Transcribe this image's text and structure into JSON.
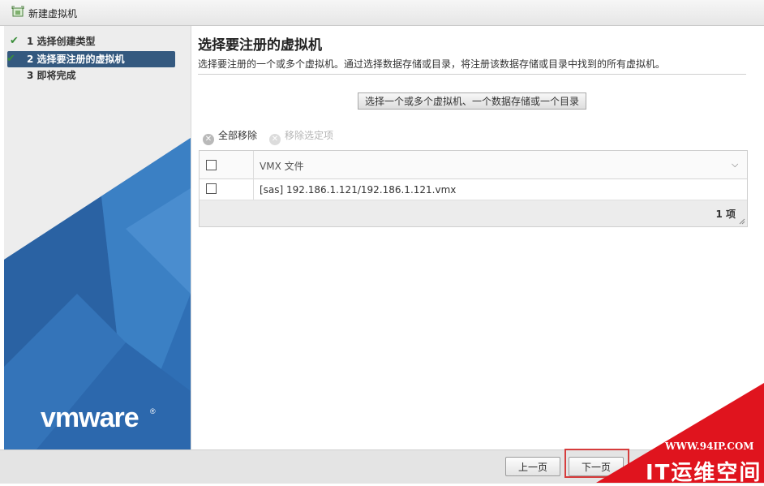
{
  "window": {
    "title": "新建虚拟机",
    "icon": "new-vm-icon"
  },
  "steps": [
    {
      "label": "1 选择创建类型",
      "completed": true,
      "active": false
    },
    {
      "label": "2 选择要注册的虚拟机",
      "completed": true,
      "active": true
    },
    {
      "label": "3 即将完成",
      "completed": false,
      "active": false
    }
  ],
  "brand": {
    "logo_text": "vmware®",
    "pane_blue": "#2f6fb5"
  },
  "main": {
    "title": "选择要注册的虚拟机",
    "description": "选择要注册的一个或多个虚拟机。通过选择数据存储或目录，将注册该数据存储或目录中找到的所有虚拟机。",
    "select_button": "选择一个或多个虚拟机、一个数据存储或一个目录",
    "remove_all": "全部移除",
    "remove_selected": "移除选定项"
  },
  "grid": {
    "column_header": "VMX 文件",
    "rows": [
      {
        "file": "[sas] 192.186.1.121/192.186.1.121.vmx",
        "checked": false
      }
    ],
    "count_label": "1 项"
  },
  "footer": {
    "back_label": "上一页",
    "next_label": "下一页"
  },
  "watermark": {
    "url": "WWW.94IP.COM",
    "text": "IT运维空间",
    "color": "#e0141e"
  },
  "colors": {
    "active_step": "#34597f",
    "check": "#3a8e3a",
    "highlight_border": "#d63c3c"
  }
}
